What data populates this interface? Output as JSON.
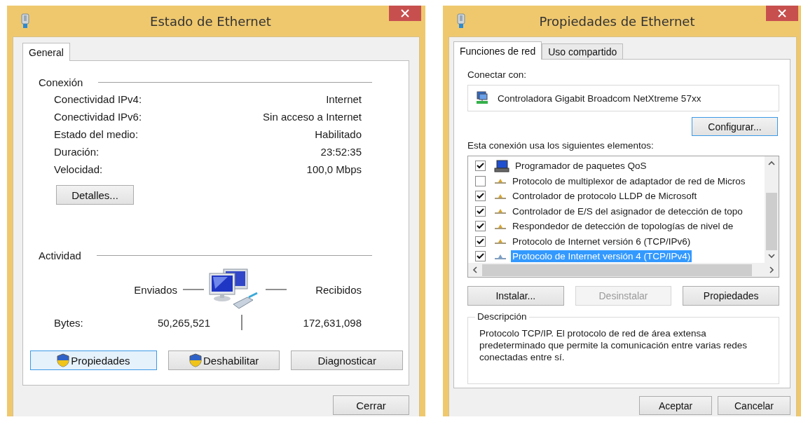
{
  "status_window": {
    "title": "Estado de Ethernet",
    "tabs": [
      {
        "label": "General",
        "selected": true
      }
    ],
    "connection": {
      "heading": "Conexión",
      "rows": [
        {
          "label": "Conectividad IPv4:",
          "value": "Internet"
        },
        {
          "label": "Conectividad IPv6:",
          "value": "Sin acceso a Internet"
        },
        {
          "label": "Estado del medio:",
          "value": "Habilitado"
        },
        {
          "label": "Duración:",
          "value": "23:52:35"
        },
        {
          "label": "Velocidad:",
          "value": "100,0 Mbps"
        }
      ]
    },
    "details_button": "Detalles...",
    "activity": {
      "heading": "Actividad",
      "sent_label": "Enviados",
      "received_label": "Recibidos",
      "bytes_label": "Bytes:",
      "sent": "50,265,521",
      "received": "172,631,098"
    },
    "buttons": [
      {
        "label": "Propiedades",
        "kind": "shield",
        "focused": true,
        "disabled": false
      },
      {
        "label": "Deshabilitar",
        "kind": "shield",
        "focused": false,
        "disabled": false
      },
      {
        "label": "Diagnosticar",
        "kind": "plain",
        "focused": false,
        "disabled": false
      }
    ],
    "close_button": "Cerrar"
  },
  "properties_window": {
    "title": "Propiedades de Ethernet",
    "tabs": [
      {
        "label": "Funciones de red",
        "selected": true
      },
      {
        "label": "Uso compartido",
        "selected": false
      }
    ],
    "connect_label": "Conectar con:",
    "adapter": "Controladora Gigabit Broadcom NetXtreme 57xx",
    "configure_button": {
      "label": "Configurar...",
      "focused": true,
      "disabled": false
    },
    "items_label": "Esta conexión usa los siguientes elementos:",
    "items": [
      {
        "label": "Programador de paquetes QoS",
        "kind": "service",
        "checked": true,
        "selected": false
      },
      {
        "label": "Protocolo de multiplexor de adaptador de red de Micros",
        "kind": "protocol",
        "checked": false,
        "selected": false
      },
      {
        "label": "Controlador de protocolo LLDP de Microsoft",
        "kind": "protocol",
        "checked": true,
        "selected": false
      },
      {
        "label": "Controlador de E/S del asignador de detección de topo",
        "kind": "protocol",
        "checked": true,
        "selected": false
      },
      {
        "label": "Respondedor de detección de topologías de nivel de",
        "kind": "protocol",
        "checked": true,
        "selected": false
      },
      {
        "label": "Protocolo de Internet versión 6 (TCP/IPv6)",
        "kind": "protocol",
        "checked": true,
        "selected": false
      },
      {
        "label": "Protocolo de Internet versión 4 (TCP/IPv4)",
        "kind": "protocol",
        "checked": true,
        "selected": true
      }
    ],
    "buttons": [
      {
        "label": "Instalar...",
        "focused": false,
        "disabled": false
      },
      {
        "label": "Desinstalar",
        "focused": false,
        "disabled": true
      },
      {
        "label": "Propiedades",
        "focused": false,
        "disabled": false
      }
    ],
    "description": {
      "heading": "Descripción",
      "text": "Protocolo TCP/IP. El protocolo de red de área extensa predeterminado que permite la comunicación entre varias redes conectadas entre sí."
    },
    "footer_buttons": [
      {
        "label": "Aceptar",
        "focused": false,
        "disabled": false
      },
      {
        "label": "Cancelar",
        "focused": false,
        "disabled": false
      }
    ]
  }
}
